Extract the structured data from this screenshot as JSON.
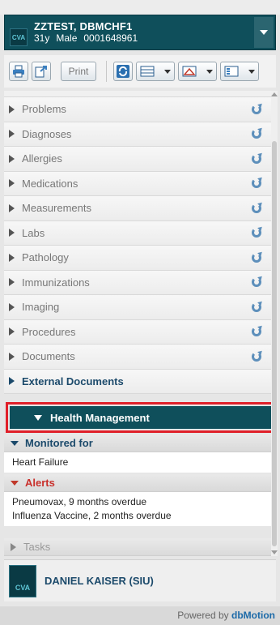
{
  "patient": {
    "badge": "CVA",
    "name": "ZZTEST, DBMCHF1",
    "age": "31y",
    "sex": "Male",
    "mrn": "0001648961"
  },
  "toolbar": {
    "print_label": "Print"
  },
  "nav": {
    "items": [
      {
        "label": "Problems"
      },
      {
        "label": "Diagnoses"
      },
      {
        "label": "Allergies"
      },
      {
        "label": "Medications"
      },
      {
        "label": "Measurements"
      },
      {
        "label": "Labs"
      },
      {
        "label": "Pathology"
      },
      {
        "label": "Immunizations"
      },
      {
        "label": "Imaging"
      },
      {
        "label": "Procedures"
      },
      {
        "label": "Documents"
      }
    ],
    "external_documents": "External Documents",
    "health_management": "Health Management"
  },
  "monitored": {
    "title": "Monitored for",
    "items": [
      "Heart Failure"
    ]
  },
  "alerts": {
    "title": "Alerts",
    "items": [
      "Pneumovax, 9 months overdue",
      "Influenza Vaccine, 2 months overdue"
    ]
  },
  "tasks": {
    "title": "Tasks"
  },
  "user": {
    "badge": "CVA",
    "name": "DANIEL KAISER (SIU)"
  },
  "footer": {
    "powered_by": "Powered by",
    "brand": "dbMotion"
  },
  "colors": {
    "header_bg": "#0f4f5b",
    "highlight_border": "#e0202a",
    "accent_blue": "#1c4a6b",
    "alert_red": "#c9302c"
  }
}
